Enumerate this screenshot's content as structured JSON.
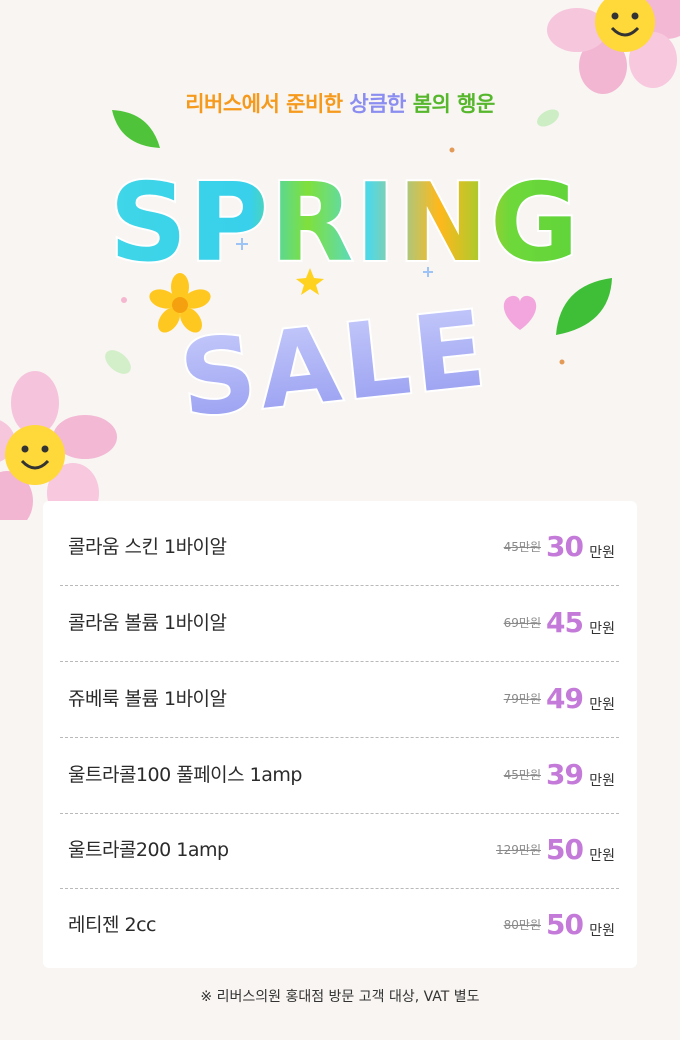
{
  "header": {
    "tagline_part1": "리버스에서 준비한",
    "tagline_part2": "상큼한",
    "tagline_part3": "봄의 행운",
    "title_line1": "SPRING",
    "title_line2": "SALE"
  },
  "colors": {
    "accent_price": "#c47ad8",
    "tagline_orange": "#f59a1c",
    "tagline_purple": "#8b8ef0",
    "tagline_green": "#56b72d"
  },
  "price_list": {
    "items": [
      {
        "name": "콜라움 스킨 1바이알",
        "old_price": "45만원",
        "price": "30",
        "unit": "만원"
      },
      {
        "name": "콜라움 볼륨 1바이알",
        "old_price": "69만원",
        "price": "45",
        "unit": "만원"
      },
      {
        "name": "쥬베룩 볼륨 1바이알",
        "old_price": "79만원",
        "price": "49",
        "unit": "만원"
      },
      {
        "name": "울트라콜100 풀페이스 1amp",
        "old_price": "45만원",
        "price": "39",
        "unit": "만원"
      },
      {
        "name": "울트라콜200 1amp",
        "old_price": "129만원",
        "price": "50",
        "unit": "만원"
      },
      {
        "name": "레티젠 2cc",
        "old_price": "80만원",
        "price": "50",
        "unit": "만원"
      }
    ]
  },
  "footnote": "※ 리버스의원 홍대점 방문 고객 대상, VAT 별도",
  "decorations": [
    "smiley-flower-icon",
    "leaf-icon",
    "yellow-flower-icon",
    "star-icon",
    "heart-icon",
    "sparkle-icon"
  ]
}
